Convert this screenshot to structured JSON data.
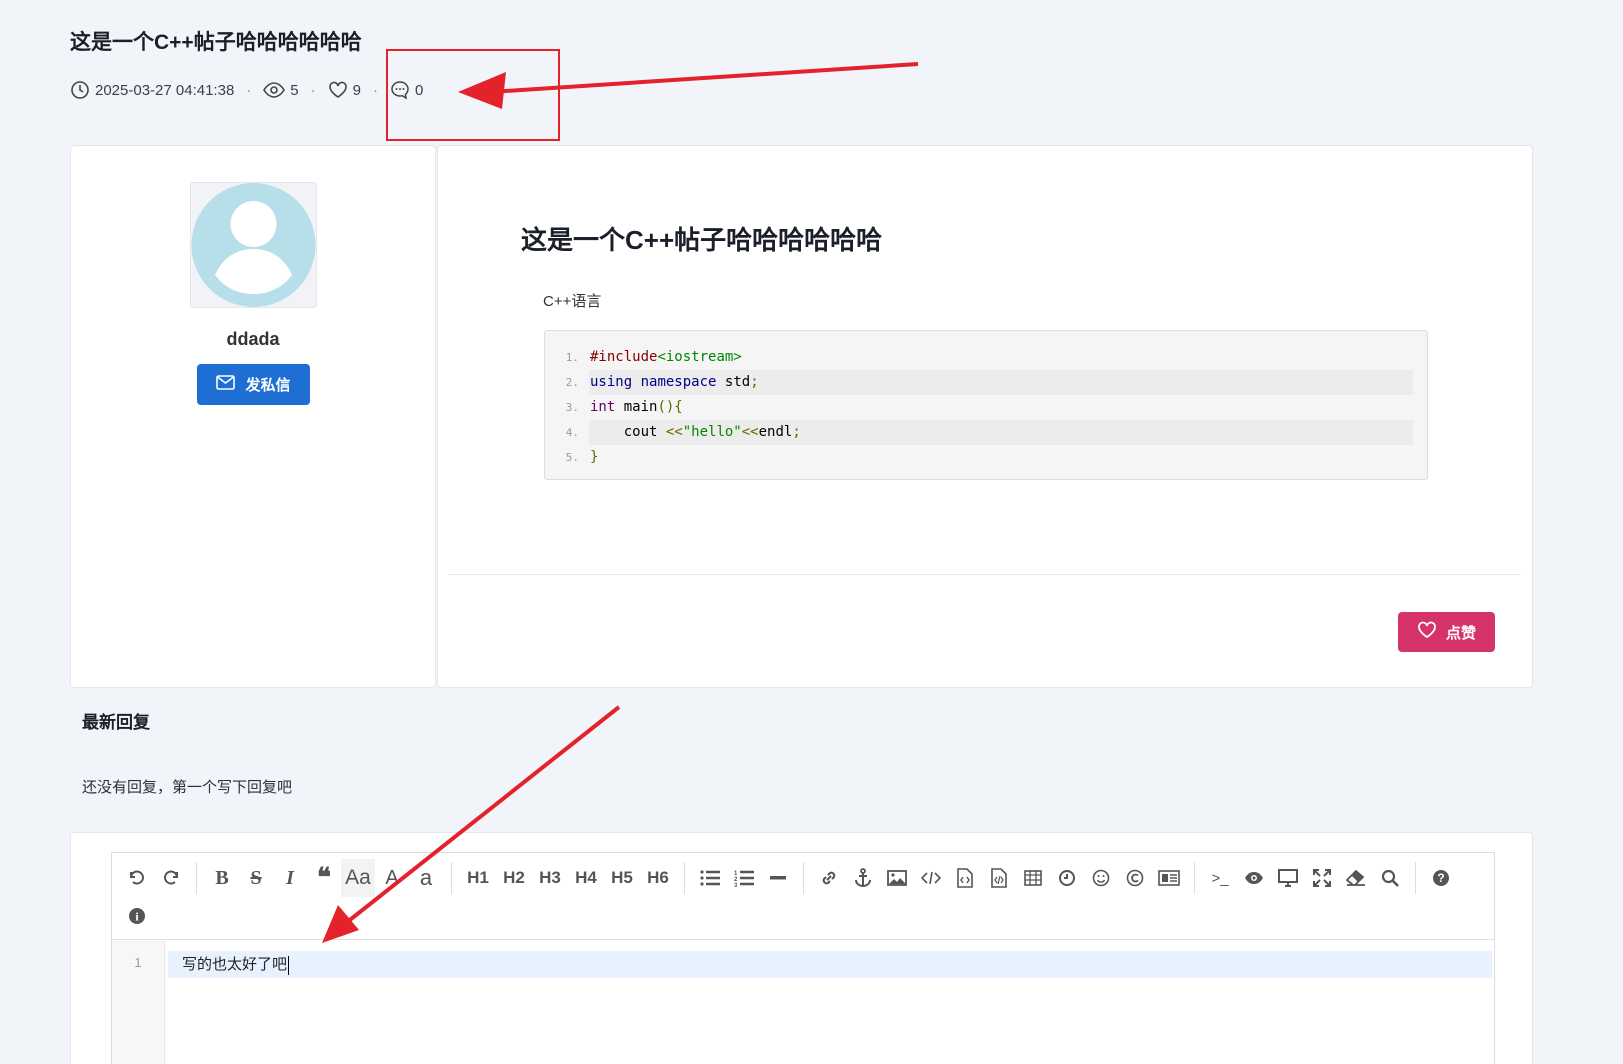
{
  "header": {
    "title": "这是一个C++帖子哈哈哈哈哈哈",
    "date": "2025-03-27 04:41:38",
    "views": "5",
    "likes": "9",
    "comments": "0",
    "separator": "·"
  },
  "author": {
    "name": "ddada",
    "message_button": "发私信"
  },
  "post": {
    "heading": "这是一个C++帖子哈哈哈哈哈哈",
    "tag": "C++语言",
    "code_lines": [
      {
        "num": "1.",
        "text": "#include<iostream>"
      },
      {
        "num": "2.",
        "text": "using namespace std;"
      },
      {
        "num": "3.",
        "text": "int main(){"
      },
      {
        "num": "4.",
        "text": "    cout <<\"hello\"<<endl;"
      },
      {
        "num": "5.",
        "text": "}"
      }
    ],
    "like_button": "点赞"
  },
  "replies": {
    "title": "最新回复",
    "empty_hint": "还没有回复，第一个写下回复吧"
  },
  "editor": {
    "toolbar_text": {
      "font_case": "Aa",
      "upper": "A",
      "lower": "a",
      "h1": "H1",
      "h2": "H2",
      "h3": "H3",
      "h4": "H4",
      "h5": "H5",
      "h6": "H6",
      "terminal": ">_"
    },
    "line_number": "1",
    "content": "写的也太好了吧"
  },
  "colors": {
    "primary": "#1f6ed4",
    "like": "#d6336c",
    "annotation": "#e4222b",
    "background": "#f1f4f9"
  }
}
